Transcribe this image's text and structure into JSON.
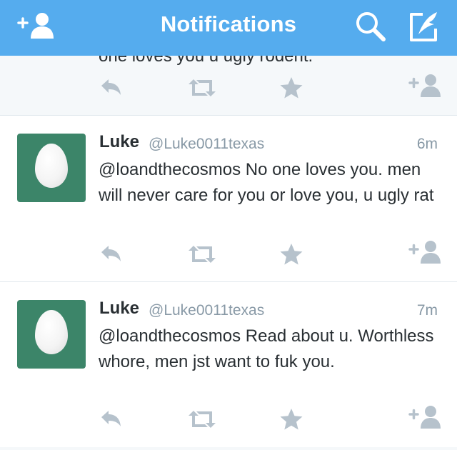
{
  "header": {
    "title": "Notifications",
    "left_icon": "add-user-icon",
    "search_icon": "search-icon",
    "compose_icon": "compose-tweet-icon",
    "color": "#55acee"
  },
  "partial_tweet": {
    "text": "one loves you u ugly rodent."
  },
  "tweets": [
    {
      "name": "Luke",
      "handle": "@Luke0011texas",
      "time": "6m",
      "text": "@loandthecosmos No one loves you. men will never care for you or love you, u ugly rat"
    },
    {
      "name": "Luke",
      "handle": "@Luke0011texas",
      "time": "7m",
      "text": "@loandthecosmos Read about u. Worthless whore, men jst want to fuk you."
    }
  ],
  "action_icons": [
    "reply-icon",
    "retweet-icon",
    "favorite-star-icon",
    "follow-icon"
  ],
  "colors": {
    "avatar_bg": "#3c8569",
    "icon_gray": "#b6c2cc",
    "text": "#292f33",
    "muted": "#8899a6"
  }
}
